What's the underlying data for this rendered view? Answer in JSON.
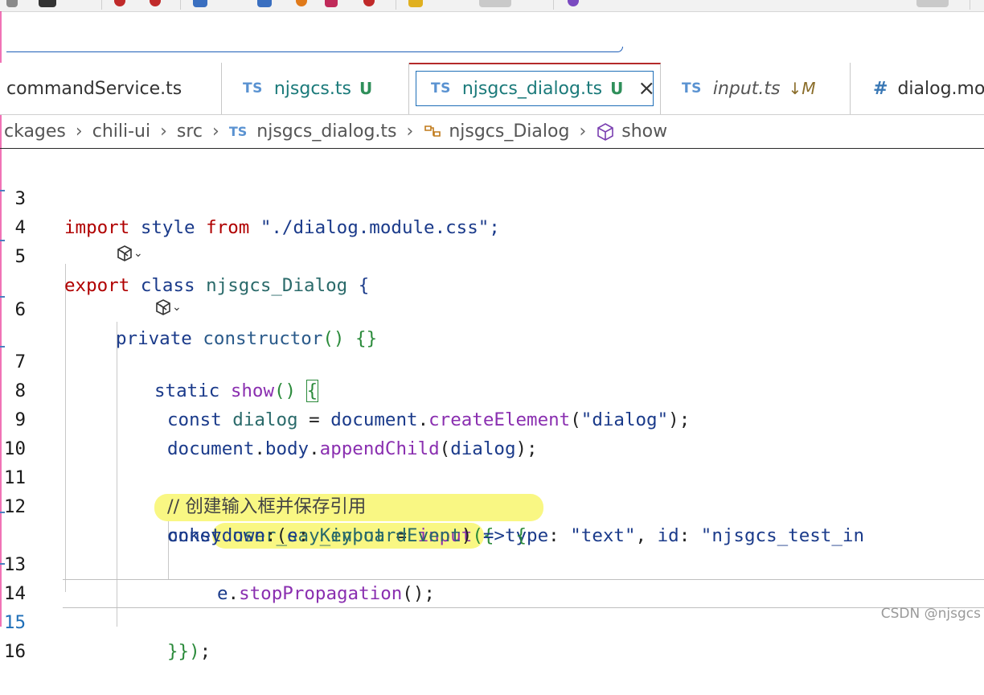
{
  "tabs": [
    {
      "label": "commandService.ts"
    },
    {
      "icon_text": "TS",
      "label": "njsgcs.ts",
      "status": "U"
    },
    {
      "icon_text": "TS",
      "label": "njsgcs_dialog.ts",
      "status": "U",
      "active": true
    },
    {
      "icon_text": "TS",
      "label": "input.ts",
      "status": "↓M"
    },
    {
      "icon_text": "#",
      "label": "dialog.mo"
    }
  ],
  "breadcrumb": {
    "items": [
      "ckages",
      "chili-ui",
      "src",
      "njsgcs_dialog.ts",
      "njsgcs_Dialog",
      "show"
    ],
    "file_icon_text": "TS"
  },
  "line_numbers": [
    "3",
    "4",
    "5",
    "6",
    "7",
    "8",
    "9",
    "10",
    "11",
    "12",
    "13",
    "14",
    "15",
    "16"
  ],
  "code": {
    "l3": {
      "t1": "import",
      "t2": " style ",
      "t3": "from",
      "t4": " \"./dialog.module.css\";"
    },
    "l5": {
      "t1": "export",
      "t2": " class ",
      "t3": "njsgcs_Dialog",
      "t4": " {"
    },
    "l6": {
      "t1": "private",
      "t2": " constructor",
      "t3": "() {}"
    },
    "l7": {
      "t1": "static",
      "t2": " show",
      "t3": "() ",
      "t4": "{"
    },
    "l8": {
      "t1": "const",
      "t2": " dialog",
      "t3": " = ",
      "t4": "document",
      "t5": ".",
      "t6": "createElement",
      "t7": "(",
      "t8": "\"dialog\"",
      "t9": ");"
    },
    "l9": {
      "t1": "document",
      "t2": ".",
      "t3": "body",
      "t4": ".",
      "t5": "appendChild",
      "t6": "(",
      "t7": "dialog",
      "t8": ");"
    },
    "l11": {
      "t1": "// 创建输入框并保存引用"
    },
    "l12": {
      "t1": "const",
      "t2": " user_say_input",
      "t3": " = ",
      "t4": "input",
      "t5": "({",
      "t6": " type",
      "t7": ": ",
      "t8": "\"text\"",
      "t9": ", ",
      "t10": "id",
      "t11": ": ",
      "t12": "\"njsgcs_test_in"
    },
    "l12b": {
      "t1": "onkeydown",
      "t2": ":(",
      "t3": "e",
      "t4": ": ",
      "t5": "KeyboardEvent",
      "t6": ")",
      "t7": " => ",
      "t8": "{"
    },
    "l13": {
      "t1": "e",
      "t2": ".",
      "t3": "stopPropagation",
      "t4": "();"
    },
    "l15": {
      "t1": "}})",
      "t2": ";"
    }
  },
  "codelens_chevron": "⌄",
  "watermark": "CSDN @njsgcs",
  "colors": {
    "keyword": "#b00000",
    "accent_blue": "#1f6fb8",
    "highlight": "#f7f45a"
  }
}
